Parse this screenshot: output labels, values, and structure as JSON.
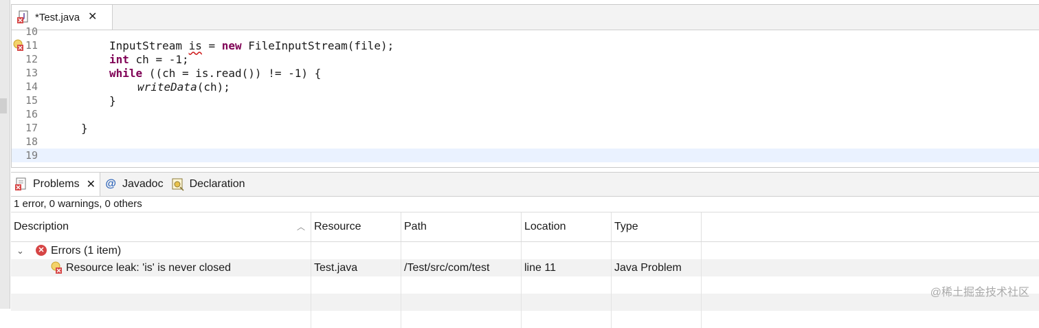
{
  "editor": {
    "tab_label": "*Test.java",
    "lines": [
      {
        "num": "10"
      },
      {
        "num": "11"
      },
      {
        "num": "12"
      },
      {
        "num": "13"
      },
      {
        "num": "14"
      },
      {
        "num": "15"
      },
      {
        "num": "16"
      },
      {
        "num": "17"
      },
      {
        "num": "18"
      },
      {
        "num": "19"
      }
    ],
    "code": {
      "l11_a": "InputStream ",
      "l11_var": "is",
      "l11_b": " = ",
      "l11_kw": "new",
      "l11_c": " FileInputStream(file);",
      "l12_kw": "int",
      "l12_rest": " ch = -1;",
      "l13_kw": "while",
      "l13_rest": " ((ch = is.read()) != -1) {",
      "l14_call": "writeData",
      "l14_rest": "(ch);",
      "l15": "}",
      "l17": "}"
    }
  },
  "panel": {
    "tabs": {
      "problems": "Problems",
      "javadoc": "Javadoc",
      "declaration": "Declaration"
    },
    "summary": "1 error, 0 warnings, 0 others",
    "columns": {
      "description": "Description",
      "resource": "Resource",
      "path": "Path",
      "location": "Location",
      "type": "Type"
    },
    "group_label": "Errors (1 item)",
    "problem": {
      "description": "Resource leak: 'is' is never closed",
      "resource": "Test.java",
      "path": "/Test/src/com/test",
      "location": "line 11",
      "type": "Java Problem"
    }
  },
  "watermark": "@稀土掘金技术社区",
  "colors": {
    "keyword": "#7f0055",
    "error": "#d64545",
    "current_line": "#eaf2ff"
  }
}
